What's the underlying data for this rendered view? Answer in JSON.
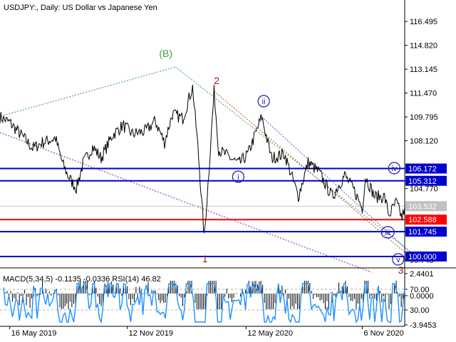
{
  "header": {
    "symbol": "USDJPY",
    "timeframe": "Daily",
    "description": "US Dollar vs Japanese Yen",
    "separator": ":"
  },
  "chart_data": [
    {
      "type": "line",
      "price_axis_ticks": [
        116.495,
        114.82,
        113.145,
        111.47,
        109.795,
        108.12,
        104.77,
        101.745,
        99.745
      ],
      "ylim": [
        99.2,
        118.0
      ],
      "x_ticks": [
        "16 May 2019",
        "12 Nov 2019",
        "12 May 2020",
        "6 Nov 2020"
      ],
      "x_tick_dates": [
        "2019-05-16",
        "2019-11-12",
        "2020-05-12",
        "2020-11-06"
      ],
      "xlim": [
        "2019-05-01",
        "2021-01-10"
      ],
      "series": [
        {
          "values": [
            [
              "2019-05-01",
              109.8
            ],
            [
              "2019-05-16",
              109.4
            ],
            [
              "2019-06-05",
              108.4
            ],
            [
              "2019-06-20",
              107.6
            ],
            [
              "2019-07-05",
              108.0
            ],
            [
              "2019-07-25",
              108.3
            ],
            [
              "2019-08-05",
              106.5
            ],
            [
              "2019-08-15",
              105.5
            ],
            [
              "2019-08-26",
              104.8
            ],
            [
              "2019-09-05",
              106.5
            ],
            [
              "2019-09-20",
              107.7
            ],
            [
              "2019-10-03",
              106.9
            ],
            [
              "2019-10-20",
              108.5
            ],
            [
              "2019-11-05",
              109.2
            ],
            [
              "2019-11-20",
              108.6
            ],
            [
              "2019-12-10",
              108.8
            ],
            [
              "2019-12-25",
              109.5
            ],
            [
              "2020-01-08",
              108.0
            ],
            [
              "2020-01-20",
              110.0
            ],
            [
              "2020-02-05",
              109.7
            ],
            [
              "2020-02-20",
              111.9
            ],
            [
              "2020-02-28",
              107.8
            ],
            [
              "2020-03-09",
              101.3
            ],
            [
              "2020-03-16",
              106.0
            ],
            [
              "2020-03-24",
              111.6
            ],
            [
              "2020-03-31",
              107.5
            ],
            [
              "2020-04-15",
              107.0
            ],
            [
              "2020-05-01",
              106.5
            ],
            [
              "2020-05-15",
              107.2
            ],
            [
              "2020-06-05",
              109.8
            ],
            [
              "2020-06-20",
              106.9
            ],
            [
              "2020-07-10",
              107.2
            ],
            [
              "2020-07-31",
              104.2
            ],
            [
              "2020-08-15",
              106.6
            ],
            [
              "2020-09-01",
              105.9
            ],
            [
              "2020-09-21",
              104.2
            ],
            [
              "2020-10-10",
              105.7
            ],
            [
              "2020-10-25",
              104.6
            ],
            [
              "2020-11-06",
              103.4
            ],
            [
              "2020-11-11",
              105.6
            ],
            [
              "2020-11-25",
              104.2
            ],
            [
              "2020-12-10",
              104.2
            ],
            [
              "2020-12-17",
              102.9
            ],
            [
              "2020-12-28",
              103.8
            ],
            [
              "2021-01-06",
              102.7
            ],
            [
              "2021-01-10",
              103.5
            ]
          ]
        }
      ],
      "last_price": 103.532,
      "horizontal_levels": [
        {
          "label": "106.172",
          "value": 106.172,
          "color": "#0000cc"
        },
        {
          "label": "105.312",
          "value": 105.312,
          "color": "#0000cc"
        },
        {
          "label": "102.588",
          "value": 102.588,
          "color": "#ff0000"
        },
        {
          "label": "101.745",
          "value": 101.745,
          "color": "#0000cc"
        },
        {
          "label": "100.000",
          "value": 100.0,
          "color": "#0000cc"
        }
      ],
      "wave_labels": [
        {
          "text": "(B)",
          "color": "#3a9c3a",
          "circled": false
        },
        {
          "text": "2",
          "color": "#a01818",
          "circled": false
        },
        {
          "text": "1",
          "color": "#a01818",
          "circled": false
        },
        {
          "text": "3",
          "color": "#a01818",
          "circled": false
        },
        {
          "text": "i",
          "color": "#1a1aa0",
          "circled": true
        },
        {
          "text": "ii",
          "color": "#1a1aa0",
          "circled": true
        },
        {
          "text": "iii",
          "color": "#1a1aa0",
          "circled": true
        },
        {
          "text": "iv",
          "color": "#1a1aa0",
          "circled": true
        },
        {
          "text": "v",
          "color": "#1a1aa0",
          "circled": true
        }
      ],
      "trendline_colors": {
        "green": "#3a9c3a",
        "red": "#c04040",
        "blue": "#4060d0",
        "purple": "#7030a0"
      }
    },
    {
      "type": "line",
      "indicator_label": "MACD(5,34,5) -0.1135 -0.0336 RSI(14) 46.82",
      "macd_axis_ticks": [
        2.4401,
        0.0,
        -3.9453
      ],
      "rsi_levels": [
        70.0,
        30.0
      ],
      "macd_color": "#000000",
      "rsi_color": "#1e90ff"
    }
  ],
  "colors": {
    "background": "#ffffff",
    "price": "#000000",
    "level_badge_blue": "#0000cc",
    "level_badge_red": "#ff0000",
    "last_price_badge": "#c0c0c0"
  }
}
